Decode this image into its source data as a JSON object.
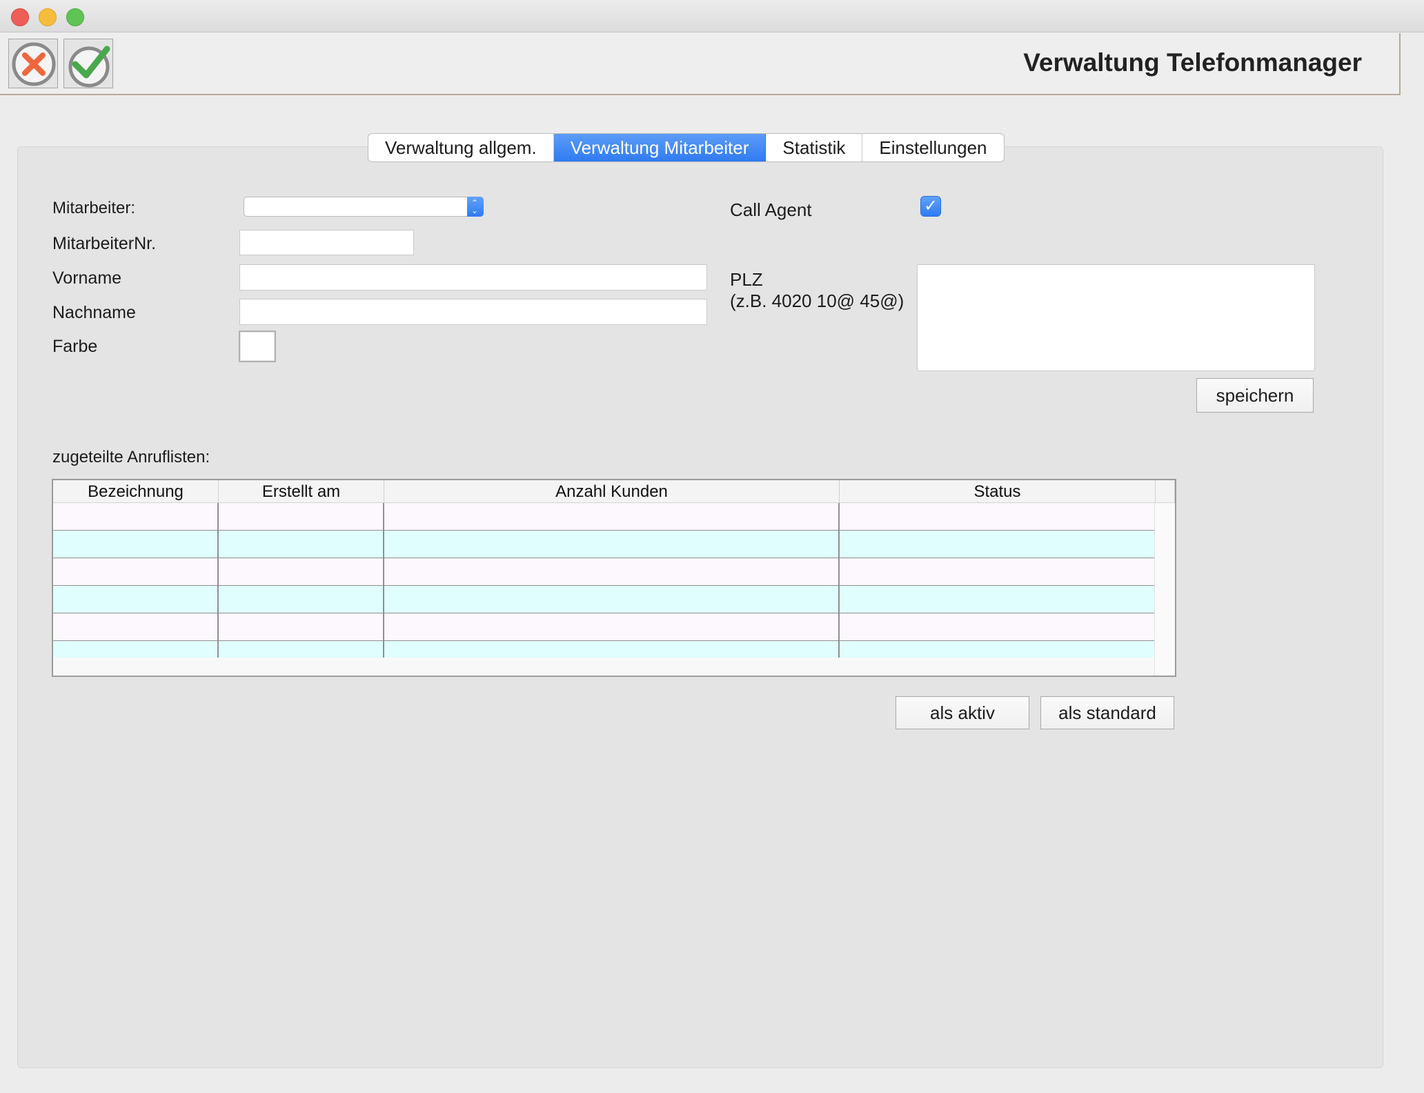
{
  "window": {
    "title": "Verwaltung Telefonmanager"
  },
  "toolbar": {
    "cancel_icon": "cancel-x-icon",
    "confirm_icon": "confirm-check-icon"
  },
  "tabs": [
    {
      "label": "Verwaltung allgem.",
      "active": false
    },
    {
      "label": "Verwaltung Mitarbeiter",
      "active": true
    },
    {
      "label": "Statistik",
      "active": false
    },
    {
      "label": "Einstellungen",
      "active": false
    }
  ],
  "form": {
    "mitarbeiter_label": "Mitarbeiter:",
    "mitarbeiter_value": "",
    "mitarbeiternr_label": "MitarbeiterNr.",
    "mitarbeiternr_value": "",
    "vorname_label": "Vorname",
    "vorname_value": "",
    "nachname_label": "Nachname",
    "nachname_value": "",
    "farbe_label": "Farbe",
    "farbe_value": "#ffffff",
    "call_agent_label": "Call Agent",
    "call_agent_checked": true,
    "plz_label": "PLZ",
    "plz_hint": "(z.B. 4020 10@ 45@)",
    "plz_value": "",
    "save_label": "speichern"
  },
  "lists": {
    "section_label": "zugeteilte Anruflisten:",
    "columns": [
      "Bezeichnung",
      "Erstellt am",
      "Anzahl Kunden",
      "Status"
    ],
    "rows": [],
    "activate_label": "als aktiv",
    "default_label": "als standard"
  },
  "colors": {
    "accent": "#2f7bf2",
    "row_odd": "#fcf8fd",
    "row_even": "#e0fefe"
  }
}
